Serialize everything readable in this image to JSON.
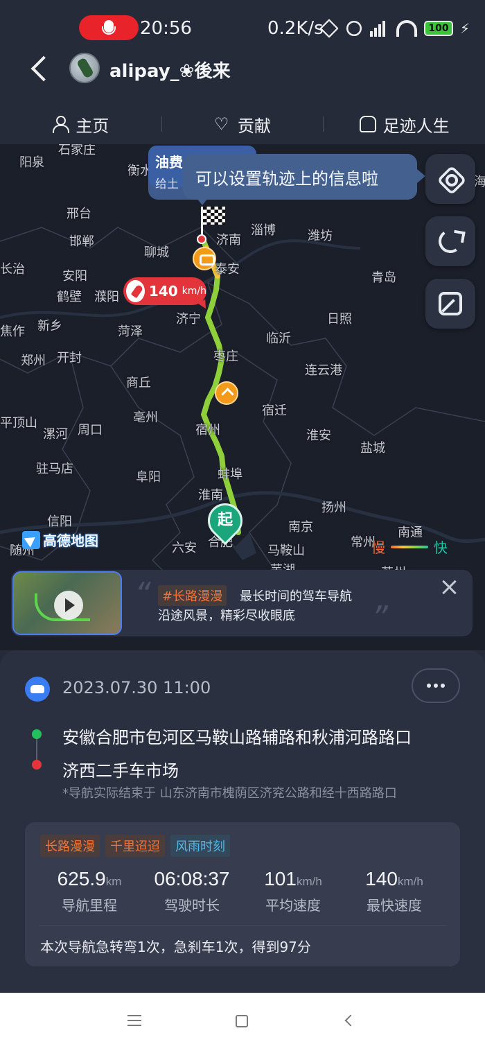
{
  "status_bar": {
    "time": "20:56",
    "net_speed": "0.2K/s",
    "battery": "100"
  },
  "header": {
    "username": "alipay_❀後来"
  },
  "tabs": [
    {
      "label": "主页",
      "icon": "person-icon"
    },
    {
      "label": "贡献",
      "icon": "heart-icon"
    },
    {
      "label": "足迹人生",
      "icon": "car-icon"
    }
  ],
  "map": {
    "tooltip_under_title": "油费",
    "tooltip_under_sub": "给土",
    "tooltip_text": "可以设置轨迹上的信息啦",
    "max_speed_value": "140",
    "max_speed_unit": "km/h",
    "start_label": "起",
    "provider": "高德地图",
    "legend_slow": "慢",
    "legend_fast": "快",
    "cities": [
      "石家庄",
      "阳泉",
      "衡水",
      "邢台",
      "邯郸",
      "长治",
      "聊城",
      "济南",
      "淄博",
      "潍坊",
      "泰安",
      "安阳",
      "鹤壁",
      "濮阳",
      "青岛",
      "焦作",
      "新乡",
      "菏泽",
      "济宁",
      "日照",
      "郑州",
      "开封",
      "临沂",
      "枣庄",
      "连云港",
      "商丘",
      "宿迁",
      "平顶山",
      "亳州",
      "漯河",
      "周口",
      "宿州",
      "淮安",
      "盐城",
      "驻马店",
      "阜阳",
      "蚌埠",
      "淮南",
      "扬州",
      "信阳",
      "南京",
      "六安",
      "合肥",
      "马鞍山",
      "常州",
      "南通",
      "随州",
      "芜湖",
      "苏州",
      "海"
    ]
  },
  "promo": {
    "tag": "#长路漫漫",
    "line1": "最长时间的驾车导航",
    "line2": "沿途风景，精彩尽收眼底"
  },
  "trip": {
    "date": "2023.07.30 11:00",
    "from": "安徽合肥市包河区马鞍山路辅路和秋浦河路路口",
    "to": "济西二手车市场",
    "note": "*导航实际结束于 山东济南市槐荫区济兖公路和经十西路路口",
    "tags": [
      "长路漫漫",
      "千里迢迢",
      "风雨时刻"
    ],
    "stats": [
      {
        "value": "625.9",
        "unit": "km",
        "label": "导航里程"
      },
      {
        "value": "06:08:37",
        "unit": "",
        "label": "驾驶时长"
      },
      {
        "value": "101",
        "unit": "km/h",
        "label": "平均速度"
      },
      {
        "value": "140",
        "unit": "km/h",
        "label": "最快速度"
      }
    ],
    "summary": "本次导航急转弯1次，急刹车1次，得到97分"
  }
}
